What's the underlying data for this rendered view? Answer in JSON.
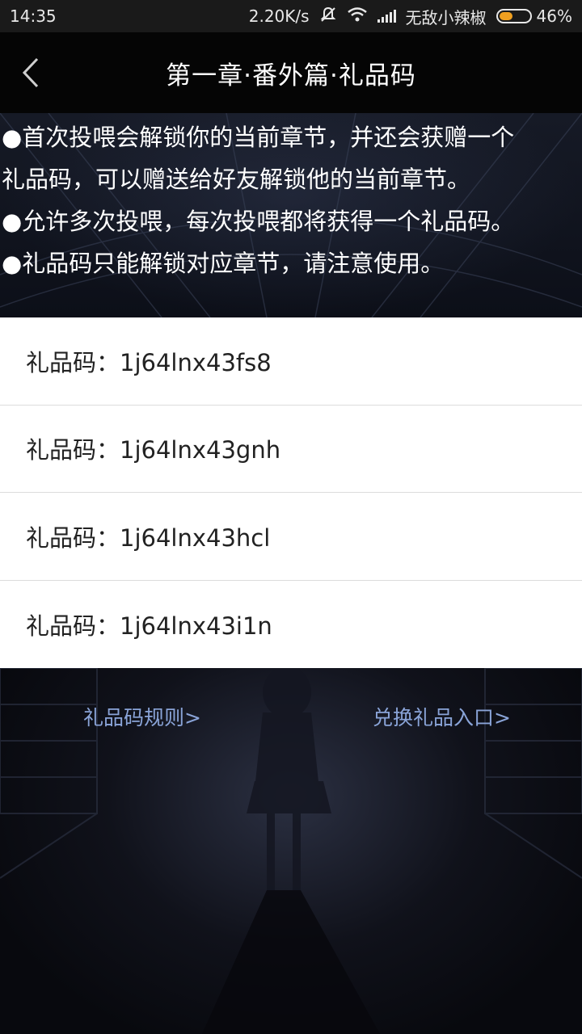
{
  "status_bar": {
    "time": "14:35",
    "network_speed": "2.20K/s",
    "carrier": "无敌小辣椒",
    "battery_percent": "46%",
    "battery_level": 0.46
  },
  "header": {
    "title": "第一章·番外篇·礼品码"
  },
  "info": {
    "lines": [
      "●首次投喂会解锁你的当前章节，并还会获赠一个",
      "礼品码，可以赠送给好友解锁他的当前章节。",
      "●允许多次投喂，每次投喂都将获得一个礼品码。",
      "●礼品码只能解锁对应章节，请注意使用。"
    ]
  },
  "codes": [
    "礼品码：1j64lnx43fs8",
    "礼品码：1j64lnx43gnh",
    "礼品码：1j64lnx43hcl",
    "礼品码：1j64lnx43i1n"
  ],
  "links": {
    "rules": "礼品码规则>",
    "redeem": "兑换礼品入口>"
  },
  "colors": {
    "link": "#8aa4d8",
    "battery": "#f0a020"
  }
}
